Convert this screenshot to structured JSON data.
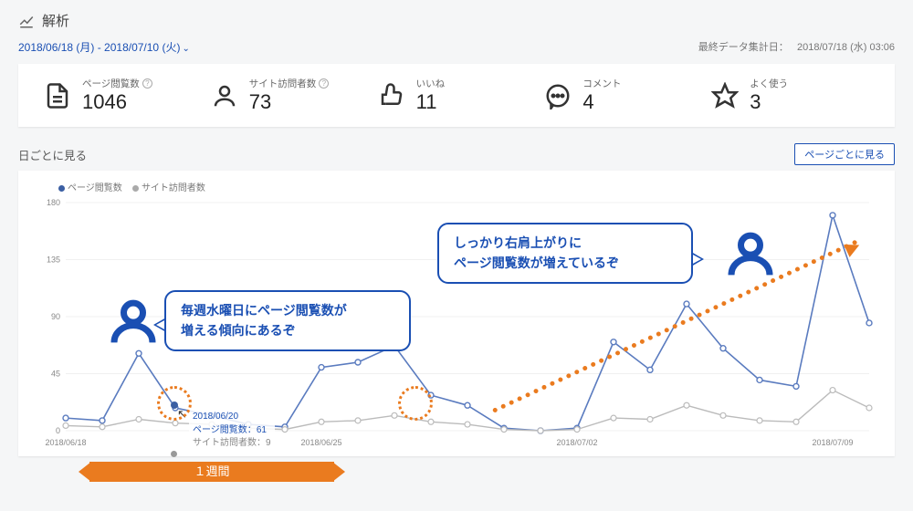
{
  "header": {
    "title": "解析"
  },
  "date_range": "2018/06/18 (月) - 2018/07/10 (火)",
  "last_aggregation": {
    "label": "最終データ集計日：",
    "value": "2018/07/18 (水) 03:06"
  },
  "stats": {
    "pageviews": {
      "label": "ページ閲覧数",
      "value": "1046"
    },
    "visitors": {
      "label": "サイト訪問者数",
      "value": "73"
    },
    "likes": {
      "label": "いいね",
      "value": "11"
    },
    "comments": {
      "label": "コメント",
      "value": "4"
    },
    "favorites": {
      "label": "よく使う",
      "value": "3"
    }
  },
  "chart_section": {
    "title": "日ごとに見る",
    "per_page_button": "ページごとに見る",
    "legend": {
      "pv": "ページ閲覧数",
      "uv": "サイト訪問者数"
    },
    "x_ticks": [
      "2018/06/18",
      "2018/06/25",
      "2018/07/02",
      "2018/07/09"
    ]
  },
  "tooltip": {
    "date": "2018/06/20",
    "pv_label": "ページ閲覧数：",
    "pv_value": "61",
    "uv_label": "サイト訪問者数：",
    "uv_value": "9"
  },
  "annotations": {
    "bubble1": "毎週水曜日にページ閲覧数が\n増える傾向にあるぞ",
    "bubble2": "しっかり右肩上がりに\nページ閲覧数が増えているぞ",
    "week_label": "１週間"
  },
  "chart_data": {
    "type": "line",
    "title": "日ごとに見る",
    "xlabel": "",
    "ylabel": "",
    "ylim": [
      0,
      180
    ],
    "y_ticks": [
      0,
      45,
      90,
      135,
      180
    ],
    "x": [
      "2018/06/18",
      "2018/06/19",
      "2018/06/20",
      "2018/06/21",
      "2018/06/22",
      "2018/06/23",
      "2018/06/24",
      "2018/06/25",
      "2018/06/26",
      "2018/06/27",
      "2018/06/28",
      "2018/06/29",
      "2018/06/30",
      "2018/07/01",
      "2018/07/02",
      "2018/07/03",
      "2018/07/04",
      "2018/07/05",
      "2018/07/06",
      "2018/07/07",
      "2018/07/08",
      "2018/07/09",
      "2018/07/10"
    ],
    "series": [
      {
        "name": "ページ閲覧数",
        "values": [
          10,
          8,
          61,
          18,
          12,
          5,
          3,
          50,
          54,
          67,
          28,
          20,
          2,
          0,
          2,
          70,
          48,
          100,
          65,
          40,
          35,
          170,
          85
        ]
      },
      {
        "name": "サイト訪問者数",
        "values": [
          4,
          3,
          9,
          6,
          5,
          2,
          1,
          7,
          8,
          12,
          7,
          5,
          1,
          0,
          1,
          10,
          9,
          20,
          12,
          8,
          7,
          32,
          18
        ]
      }
    ],
    "x_axis_ticks": [
      "2018/06/18",
      "2018/06/25",
      "2018/07/02",
      "2018/07/09"
    ]
  }
}
